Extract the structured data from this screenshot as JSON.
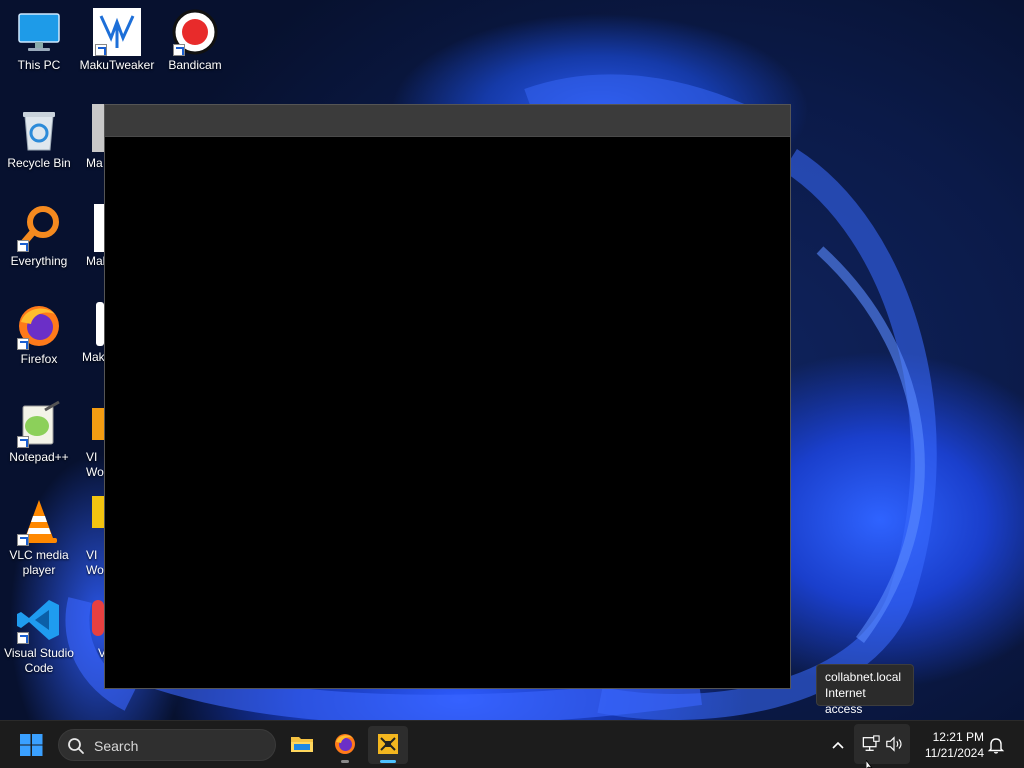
{
  "desktop": {
    "icons": [
      {
        "label": "This PC"
      },
      {
        "label": "MakuTweaker"
      },
      {
        "label": "Bandicam"
      },
      {
        "label": "Recycle Bin"
      },
      {
        "label": "Everything"
      },
      {
        "label": "Firefox"
      },
      {
        "label": "Notepad++"
      },
      {
        "label": "VLC media player"
      },
      {
        "label": "Visual Studio Code"
      }
    ],
    "partial_labels": [
      "Ma",
      "Mal",
      "Mak",
      "VI",
      "Wo",
      "VI",
      "Wo",
      "V"
    ]
  },
  "tooltip": {
    "line1": "collabnet.local",
    "line2": "Internet access"
  },
  "taskbar": {
    "search_label": "Search",
    "time": "12:21 PM",
    "date": "11/21/2024",
    "apps": [
      "file-explorer",
      "firefox",
      "vmware"
    ]
  },
  "colors": {
    "taskbar_bg": "#1c1c1c",
    "accent_indicator": "#4cc2ff",
    "window_bg": "#000000",
    "window_titlebar": "#3b3b3b"
  }
}
